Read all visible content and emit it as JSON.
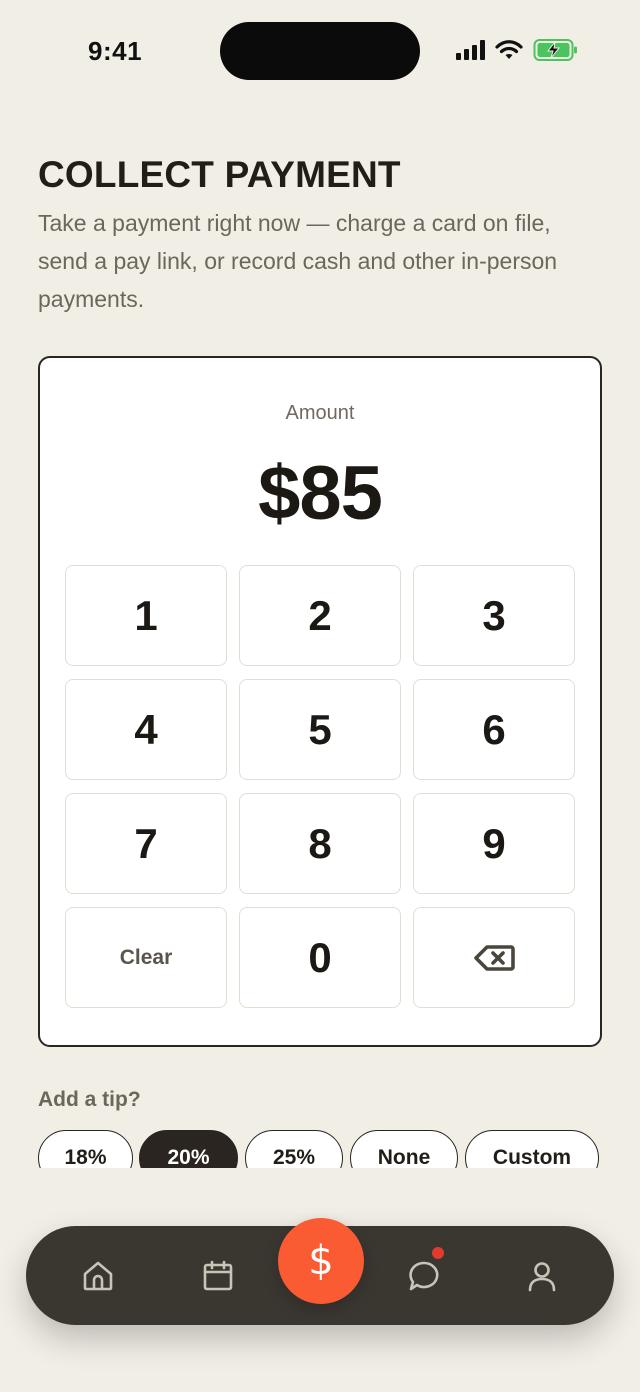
{
  "status_bar": {
    "time": "9:41",
    "icons": [
      "signal-icon",
      "wifi-icon",
      "battery-charging-icon"
    ]
  },
  "header": {
    "title": "COLLECT PAYMENT",
    "description": "Take a payment right now — charge a card on file, send a pay link, or record cash and other in-person payments."
  },
  "amount": {
    "label": "Amount",
    "value": "$85"
  },
  "keypad": {
    "keys": [
      "1",
      "2",
      "3",
      "4",
      "5",
      "6",
      "7",
      "8",
      "9",
      "Clear",
      "0"
    ],
    "backspace_icon": "backspace-icon"
  },
  "tip": {
    "label": "Add a tip?",
    "options": [
      "18%",
      "20%",
      "25%",
      "None",
      "Custom"
    ],
    "selected": "20%"
  },
  "nav": {
    "items": [
      "home-icon",
      "calendar-icon",
      "dollar-icon",
      "chat-icon",
      "profile-icon"
    ],
    "active": "dollar-icon",
    "fab_symbol": "$"
  },
  "colors": {
    "background": "#f1eee6",
    "accent": "#fb5b33",
    "nav": "#3a3731",
    "text": "#211d17",
    "muted": "#6c665c",
    "notification": "#e23a2e"
  }
}
